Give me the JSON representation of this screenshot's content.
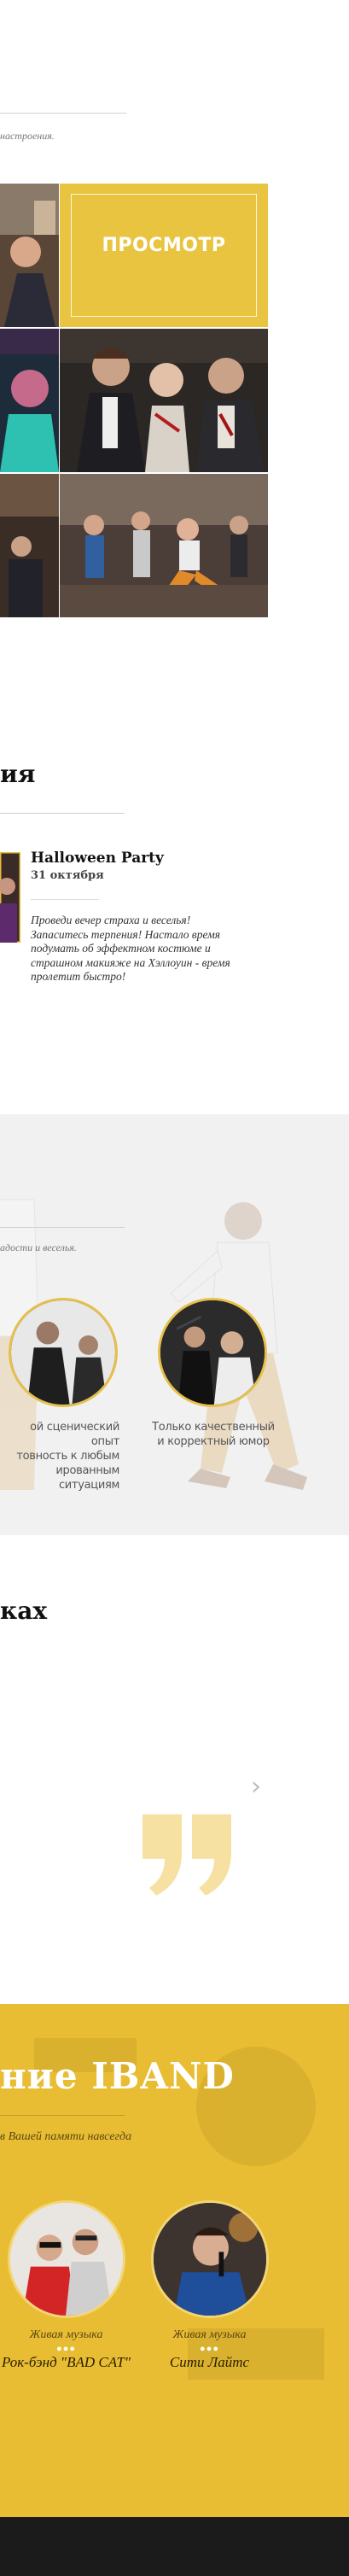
{
  "gallery": {
    "tagline_tail": "настроения.",
    "view_button": "ПРОСМОТР"
  },
  "events": {
    "title_tail": "ия",
    "item": {
      "title": "Halloween Party",
      "date": "31 октября",
      "text_lines": [
        "Проведи вечер страха и веселья!",
        "Запаситесь терпения! Настало время",
        "подумать об эффектном костюме и",
        "страшном макияже на Хэллоуин - время",
        "пролетит быстро!"
      ]
    }
  },
  "benefits": {
    "subtitle_tail": "адости и веселья.",
    "items": [
      {
        "lines": [
          "ой сценический опыт",
          "товность к любым",
          "ированным ситуациям"
        ]
      },
      {
        "lines": [
          "Только качественный",
          "и корректный юмор"
        ]
      }
    ]
  },
  "reviews": {
    "title_tail": "ках",
    "next_arrow": "›"
  },
  "artists": {
    "title_tail": "ние IBAND",
    "subtitle": "в Вашей памяти навсегда",
    "dots": "●●●",
    "items": [
      {
        "genre": "Живая музыка",
        "name": "Рок-бэнд \"BAD CAT\""
      },
      {
        "genre": "Живая музыка",
        "name": "Сити Лайтс"
      }
    ]
  },
  "colors": {
    "accent_yellow": "#e8bd33",
    "grey_band": "#f1f1f1",
    "dark_footer": "#1b1b1b"
  }
}
